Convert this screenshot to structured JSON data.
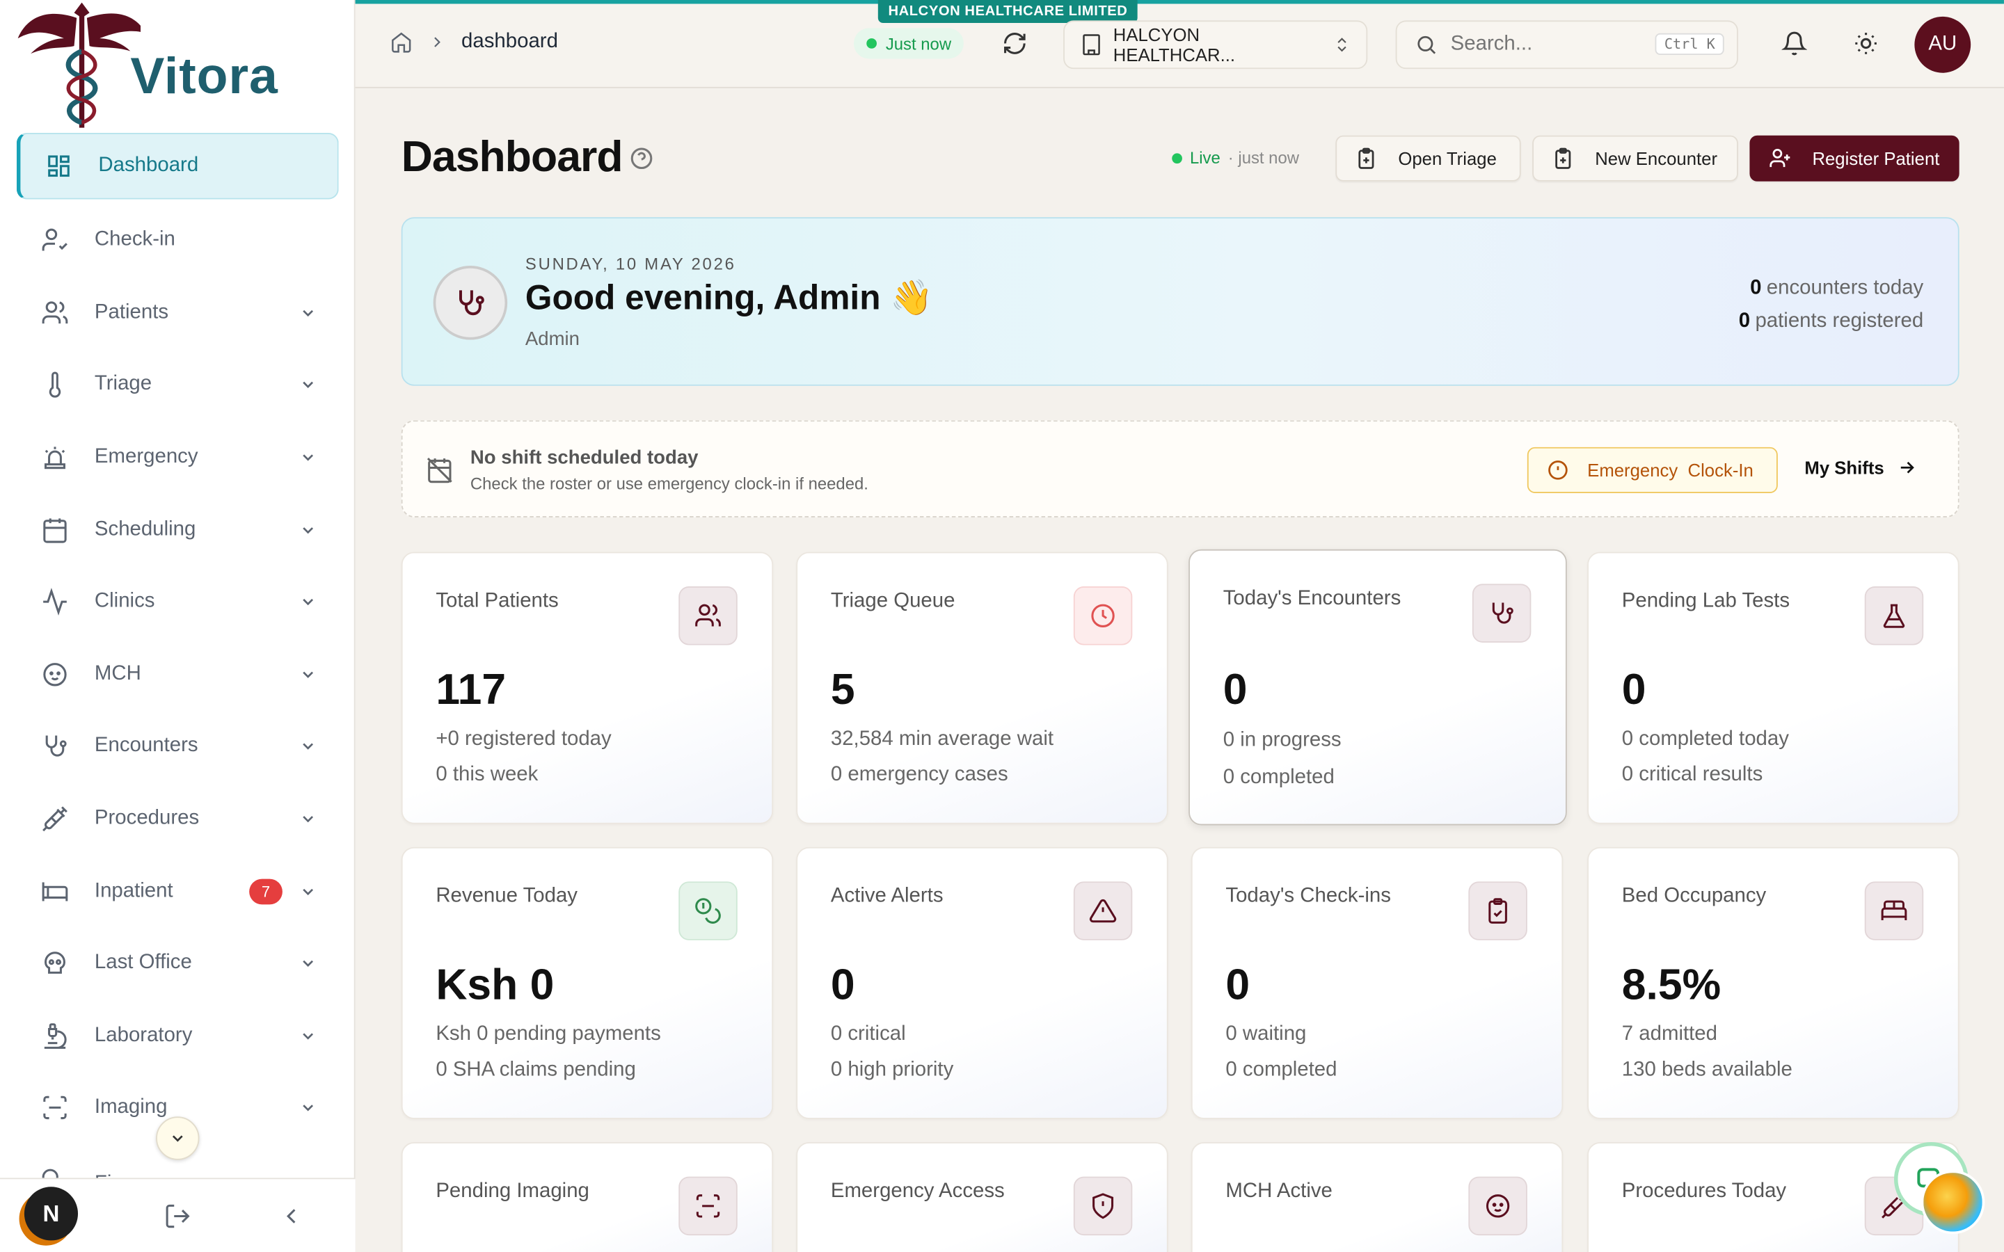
{
  "app": {
    "name": "Vitora",
    "org_tag": "HALCYON HEALTHCARE LIMITED"
  },
  "sidebar": {
    "items": [
      {
        "label": "Dashboard",
        "icon": "grid-icon",
        "active": true
      },
      {
        "label": "Check-in",
        "icon": "user-check-icon"
      },
      {
        "label": "Patients",
        "icon": "users-icon"
      },
      {
        "label": "Triage",
        "icon": "thermometer-icon"
      },
      {
        "label": "Emergency",
        "icon": "siren-icon"
      },
      {
        "label": "Scheduling",
        "icon": "calendar-icon"
      },
      {
        "label": "Clinics",
        "icon": "activity-icon"
      },
      {
        "label": "MCH",
        "icon": "baby-icon"
      },
      {
        "label": "Encounters",
        "icon": "stethoscope-icon"
      },
      {
        "label": "Procedures",
        "icon": "syringe-icon"
      },
      {
        "label": "Inpatient",
        "icon": "bed-icon",
        "badge": "7"
      },
      {
        "label": "Last Office",
        "icon": "skull-icon"
      },
      {
        "label": "Laboratory",
        "icon": "microscope-icon"
      },
      {
        "label": "Imaging",
        "icon": "scan-icon"
      },
      {
        "label": "Finance",
        "icon": "coins-icon"
      }
    ],
    "user_initial": "N"
  },
  "header": {
    "breadcrumb": "dashboard",
    "status": "Just now",
    "org": "HALCYON HEALTHCAR...",
    "search_placeholder": "Search...",
    "shortcut": "Ctrl K",
    "avatar": "AU"
  },
  "page": {
    "title": "Dashboard",
    "live_label": "Live",
    "live_time": "· just now",
    "buttons": {
      "triage": "Open Triage",
      "encounter": "New Encounter",
      "register": "Register Patient"
    }
  },
  "welcome": {
    "date": "SUNDAY, 10 MAY 2026",
    "greeting": "Good evening, Admin 👋",
    "role": "Admin",
    "encounters_count": "0",
    "encounters_label": "encounters today",
    "patients_count": "0",
    "patients_label": "patients registered"
  },
  "shift": {
    "title": "No shift scheduled today",
    "subtitle": "Check the roster or use emergency clock-in if needed.",
    "emergency_button": "Emergency  Clock-In",
    "my_shifts": "My Shifts"
  },
  "cards": [
    {
      "title": "Total Patients",
      "value": "117",
      "s1": "+0 registered today",
      "s2": "0 this week",
      "icon": "users-icon"
    },
    {
      "title": "Triage Queue",
      "value": "5",
      "s1": "32,584 min average wait",
      "s2": "0 emergency cases",
      "icon": "clock-icon"
    },
    {
      "title": "Today's Encounters",
      "value": "0",
      "s1": "0 in progress",
      "s2": "0 completed",
      "icon": "stethoscope-icon"
    },
    {
      "title": "Pending Lab Tests",
      "value": "0",
      "s1": "0 completed today",
      "s2": "0 critical results",
      "icon": "flask-icon"
    },
    {
      "title": "Revenue Today",
      "value": "Ksh 0",
      "s1": "Ksh 0 pending payments",
      "s2": "0 SHA claims pending",
      "icon": "coins-icon"
    },
    {
      "title": "Active Alerts",
      "value": "0",
      "s1": "0 critical",
      "s2": "0 high priority",
      "icon": "alert-triangle-icon"
    },
    {
      "title": "Today's Check-ins",
      "value": "0",
      "s1": "0 waiting",
      "s2": "0 completed",
      "icon": "clipboard-check-icon"
    },
    {
      "title": "Bed Occupancy",
      "value": "8.5%",
      "s1": "7 admitted",
      "s2": "130 beds available",
      "icon": "bed-icon"
    },
    {
      "title": "Pending Imaging",
      "icon": "scan-icon"
    },
    {
      "title": "Emergency Access",
      "icon": "shield-alert-icon"
    },
    {
      "title": "MCH Active",
      "icon": "baby-icon"
    },
    {
      "title": "Procedures Today",
      "icon": "syringe-icon"
    }
  ]
}
